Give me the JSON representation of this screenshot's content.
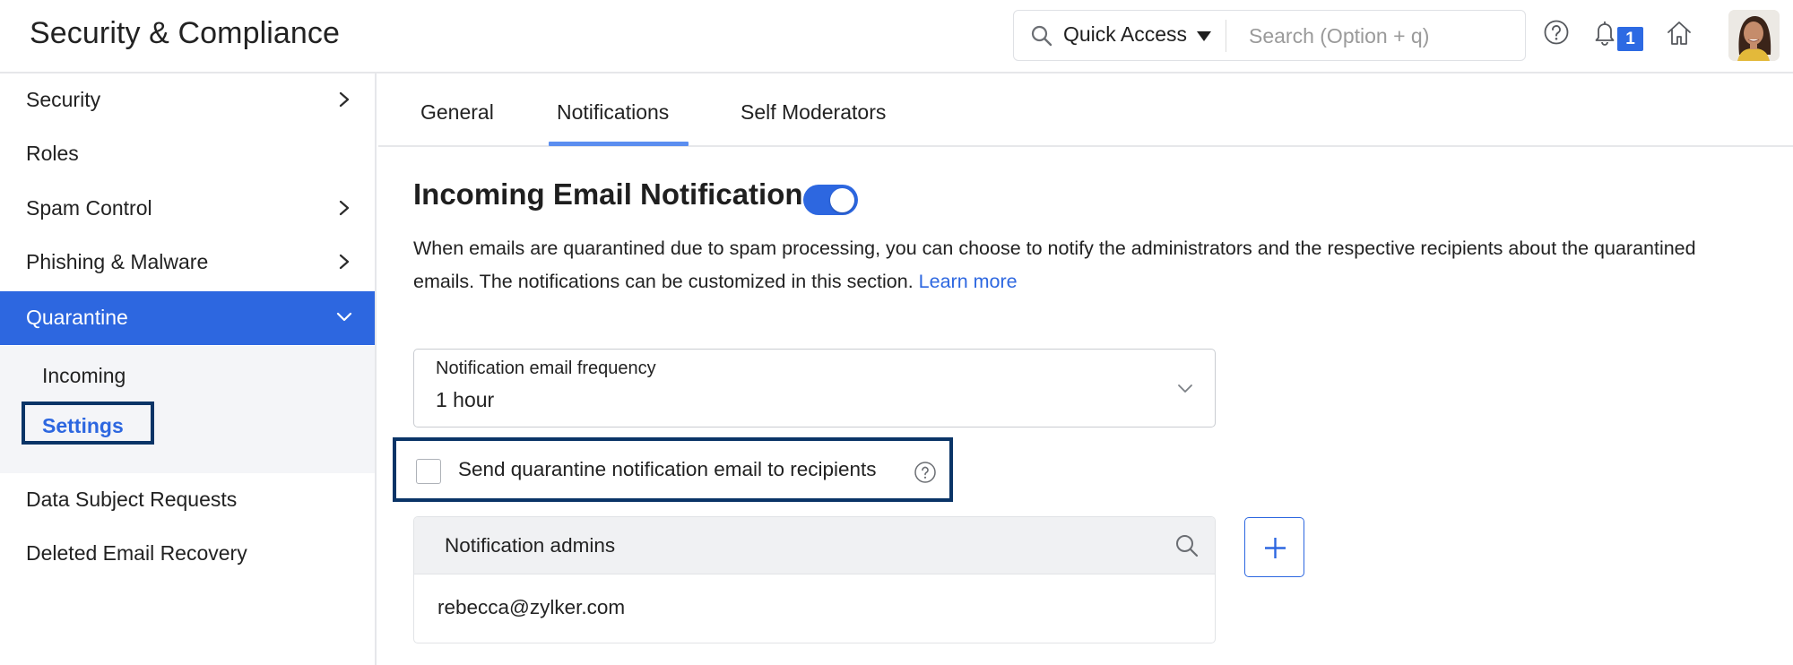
{
  "header": {
    "app_title": "Security & Compliance",
    "quick_access_label": "Quick Access",
    "search_placeholder": "Search (Option + q)",
    "notification_count": "1",
    "icons": [
      "search-icon",
      "caret-down-icon",
      "help-icon",
      "bell-icon",
      "home-icon",
      "avatar"
    ]
  },
  "sidebar": {
    "items": [
      {
        "label": "Security",
        "has_chevron": true,
        "chevron": "chevron-right-icon"
      },
      {
        "label": "Roles",
        "has_chevron": false
      },
      {
        "label": "Spam Control",
        "has_chevron": true,
        "chevron": "chevron-right-icon"
      },
      {
        "label": "Phishing & Malware",
        "has_chevron": true,
        "chevron": "chevron-right-icon"
      },
      {
        "label": "Quarantine",
        "has_chevron": true,
        "chevron": "chevron-down-icon",
        "active": true
      },
      {
        "label": "Data Subject Requests",
        "has_chevron": false
      },
      {
        "label": "Deleted Email Recovery",
        "has_chevron": false
      }
    ],
    "submenu": [
      {
        "label": "Incoming"
      },
      {
        "label": "Settings",
        "selected": true
      }
    ]
  },
  "tabs": [
    {
      "label": "General"
    },
    {
      "label": "Notifications",
      "active": true
    },
    {
      "label": "Self Moderators"
    }
  ],
  "main": {
    "section_title": "Incoming Email Notification",
    "toggle_on": true,
    "description": "When emails are quarantined due to spam processing, you can choose to notify the administrators and the respective recipients about the quarantined emails. The notifications can be customized in this section. ",
    "learn_more": "Learn more",
    "frequency": {
      "label": "Notification email frequency",
      "value": "1 hour"
    },
    "send_to_recipients": {
      "label": "Send quarantine notification email to recipients",
      "checked": false
    },
    "admins": {
      "title": "Notification admins",
      "emails": [
        "rebecca@zylker.com"
      ]
    }
  },
  "colors": {
    "accent": "#2d67e0",
    "highlight_border": "#0a3467",
    "tab_underline": "#5b8ef0",
    "submenu_bg": "#f4f5f8"
  }
}
